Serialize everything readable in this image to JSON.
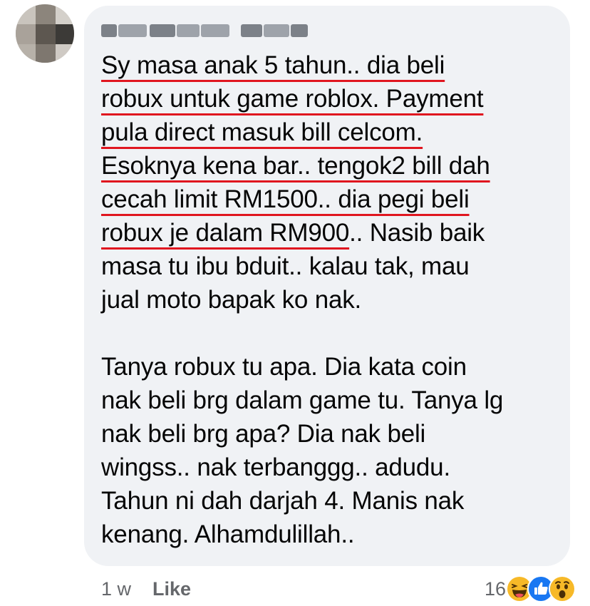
{
  "comment": {
    "author_name": "",
    "lines": [
      "Sy masa anak 5 tahun.. dia beli",
      "robux untuk game roblox. Payment",
      "pula direct masuk bill celcom.",
      "Esoknya kena bar.. tengok2 bill dah",
      "cecah limit RM1500.. dia pegi beli",
      "robux je dalam RM900",
      ".. Nasib baik",
      "masa tu ibu bduit.. kalau tak, mau",
      "jual moto bapak ko nak.",
      "Tanya robux tu apa. Dia kata coin",
      "nak beli brg dalam game tu. Tanya lg",
      "nak beli brg apa? Dia nak beli",
      "wingss.. nak terbanggg.. adudu.",
      "Tahun ni dah darjah 4. Manis nak",
      "kenang. Alhamdulillah.."
    ],
    "underline_color": "#e0161f"
  },
  "footer": {
    "timestamp": "1 w",
    "like_label": "Like"
  },
  "reactions": {
    "count": "16",
    "icons": [
      "haha-icon",
      "like-icon",
      "wow-icon"
    ]
  },
  "colors": {
    "bubble_bg": "#f0f2f5",
    "text": "#050505",
    "meta_text": "#65676b",
    "like_blue": "#1877f2",
    "reaction_yellow": "#f7b928"
  }
}
